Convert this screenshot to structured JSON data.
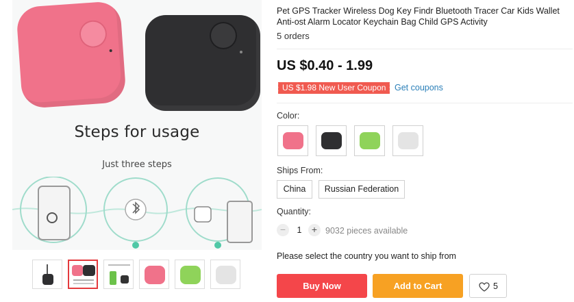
{
  "gallery": {
    "main_image": {
      "steps_title": "Steps for usage",
      "steps_subtitle": "Just three steps"
    },
    "thumbnails": [
      {
        "name": "thumb-tracker-keychain",
        "color": "#2f2f31"
      },
      {
        "name": "thumb-tracker-pair",
        "color": "#f0728a"
      },
      {
        "name": "thumb-tracker-package",
        "color": "#6cc24a"
      },
      {
        "name": "thumb-tracker-pink",
        "color": "#f0728a"
      },
      {
        "name": "thumb-tracker-green",
        "color": "#8fd35a"
      },
      {
        "name": "thumb-tracker-white",
        "color": "#e4e4e4"
      }
    ]
  },
  "product": {
    "title": "Pet GPS Tracker Wireless Dog Key Findr Bluetooth Tracer Car Kids Wallet Anti-ost Alarm Locator Keychain Bag Child GPS Activity",
    "orders": "5 orders",
    "price": "US $0.40 - 1.99",
    "coupon": "US $1.98 New User Coupon",
    "get_coupons": "Get coupons"
  },
  "options": {
    "color_label": "Color:",
    "colors": [
      {
        "name": "pink",
        "hex": "#f0728a"
      },
      {
        "name": "black",
        "hex": "#2f2f31"
      },
      {
        "name": "green",
        "hex": "#8fd35a"
      },
      {
        "name": "white",
        "hex": "#e4e4e4"
      }
    ],
    "ships_from_label": "Ships From:",
    "ships_from": [
      "China",
      "Russian Federation"
    ],
    "quantity_label": "Quantity:",
    "quantity_minus": "−",
    "quantity_value": "1",
    "quantity_plus": "+",
    "available": "9032 pieces available",
    "ship_note": "Please select the country you want to ship from"
  },
  "actions": {
    "buy_now": "Buy Now",
    "add_to_cart": "Add to Cart",
    "wishlist_count": "5"
  },
  "colors": {
    "buy_now_bg": "#f4464a",
    "add_to_cart_bg": "#f7a123",
    "coupon_bg": "#f05a50",
    "link": "#2a7fb8"
  }
}
